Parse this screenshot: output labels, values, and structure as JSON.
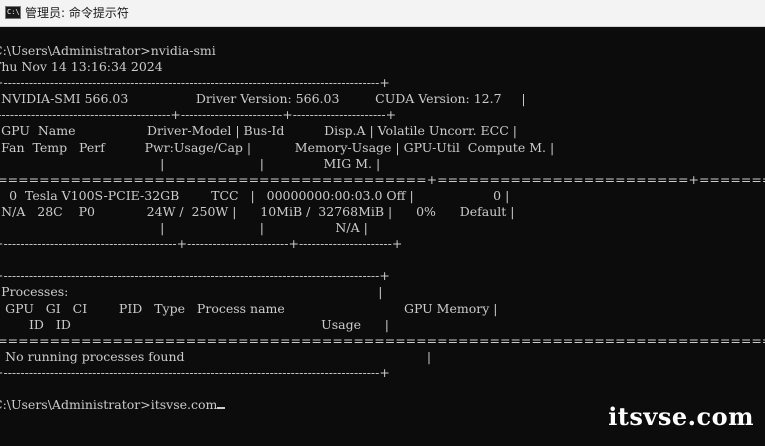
{
  "window": {
    "title": "管理员: 命令提示符",
    "icon": "cmd-icon",
    "icon_glyph": "C:\\"
  },
  "terminal": {
    "lines": [
      "C:\\Users\\Administrator>nvidia-smi",
      "Thu Nov 14 13:16:34 2024",
      "+-----------------------------------------------------------------------------------------+",
      "| NVIDIA-SMI 566.03                 Driver Version: 566.03         CUDA Version: 12.7     |",
      "|-----------------------------------------+------------------------+----------------------+",
      "| GPU  Name                  Driver-Model | Bus-Id          Disp.A | Volatile Uncorr. ECC |",
      "| Fan  Temp   Perf          Pwr:Usage/Cap |           Memory-Usage | GPU-Util  Compute M. |",
      "|                                         |                        |               MIG M. |",
      "|=========================================+========================+======================|",
      "|   0  Tesla V100S-PCIE-32GB        TCC   |   00000000:00:03.0 Off |                    0 |",
      "| N/A   28C    P0             24W /  250W |      10MiB /  32768MiB |      0%      Default |",
      "|                                         |                        |                  N/A |",
      "+-----------------------------------------+------------------------+----------------------+",
      "",
      "+-----------------------------------------------------------------------------------------+",
      "| Processes:                                                                              |",
      "|  GPU   GI   CI        PID   Type   Process name                              GPU Memory |",
      "|        ID   ID                                                               Usage      |",
      "|=========================================================================================|",
      "|  No running processes found                                                             |",
      "+-----------------------------------------------------------------------------------------+",
      "",
      "C:\\Users\\Administrator>itsvse.com"
    ]
  },
  "watermark": {
    "text": "itsvse.com"
  }
}
